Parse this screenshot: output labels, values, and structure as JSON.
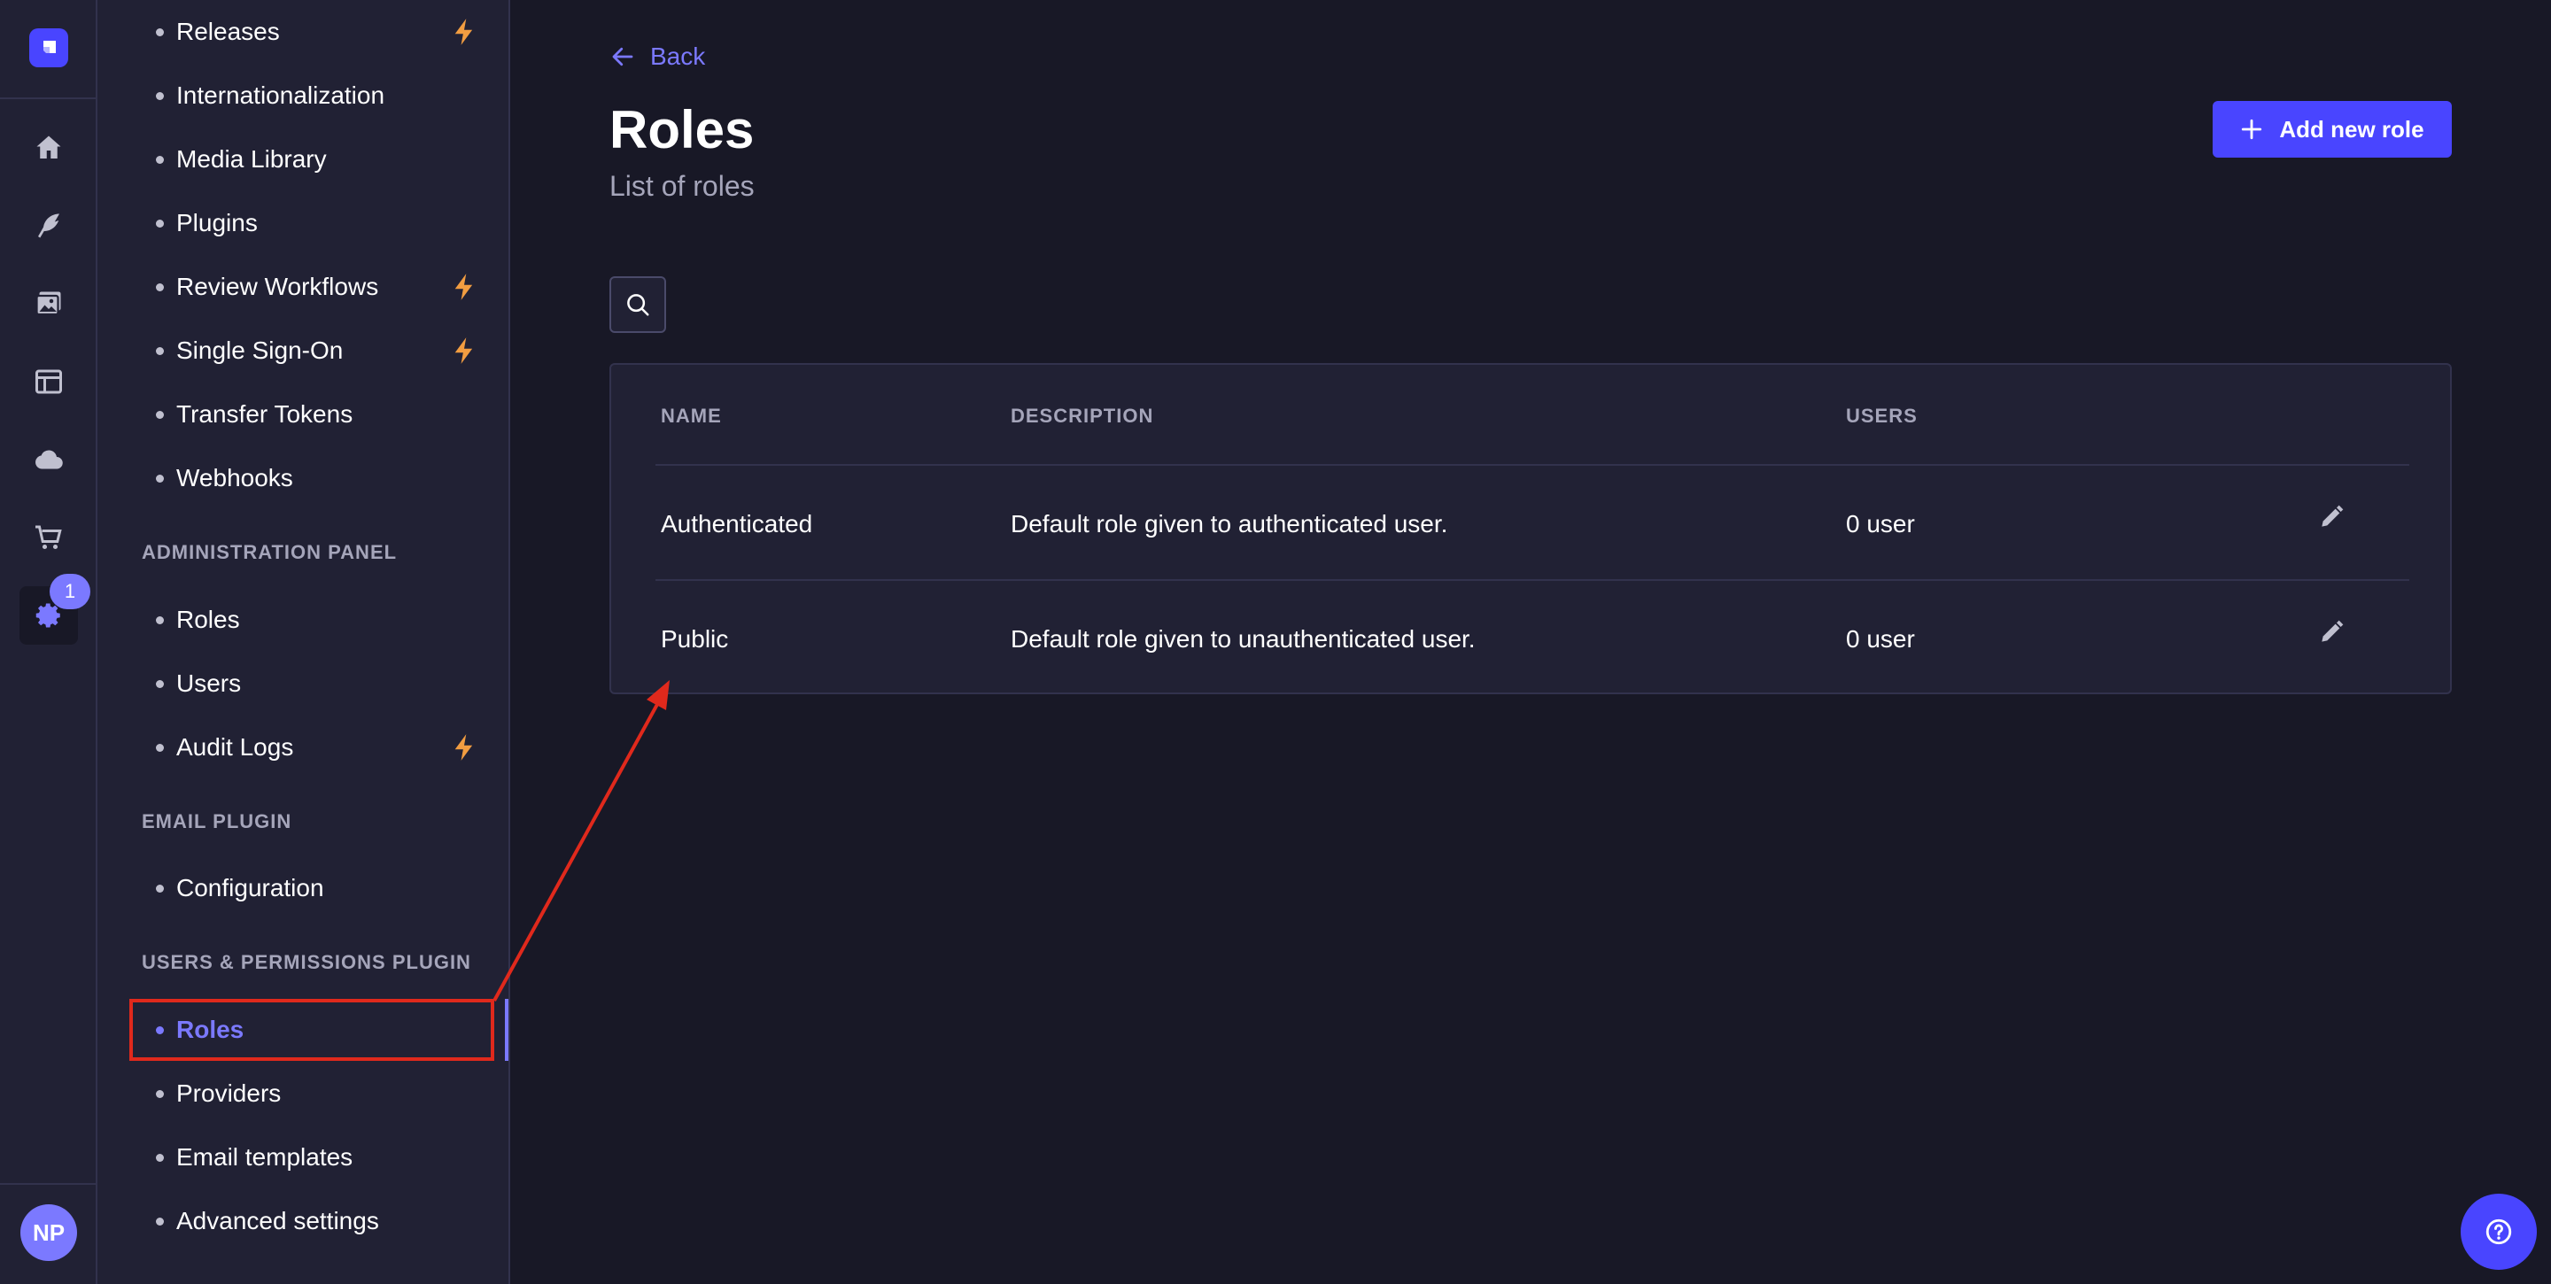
{
  "sidebar": {
    "items_top": [
      {
        "label": "Releases",
        "premium": true
      },
      {
        "label": "Internationalization",
        "premium": false
      },
      {
        "label": "Media Library",
        "premium": false
      },
      {
        "label": "Plugins",
        "premium": false
      },
      {
        "label": "Review Workflows",
        "premium": true
      },
      {
        "label": "Single Sign-On",
        "premium": true
      },
      {
        "label": "Transfer Tokens",
        "premium": false
      },
      {
        "label": "Webhooks",
        "premium": false
      }
    ],
    "admin_section": "ADMINISTRATION PANEL",
    "admin_items": [
      {
        "label": "Roles",
        "premium": false
      },
      {
        "label": "Users",
        "premium": false
      },
      {
        "label": "Audit Logs",
        "premium": true
      }
    ],
    "email_section": "EMAIL PLUGIN",
    "email_items": [
      {
        "label": "Configuration"
      }
    ],
    "up_section": "USERS & PERMISSIONS PLUGIN",
    "up_items": [
      {
        "label": "Roles",
        "active": true
      },
      {
        "label": "Providers"
      },
      {
        "label": "Email templates"
      },
      {
        "label": "Advanced settings"
      }
    ]
  },
  "rail": {
    "icons": [
      "home-icon",
      "feather-icon",
      "images-icon",
      "layout-icon",
      "cloud-icon",
      "cart-icon",
      "settings-icon"
    ],
    "settings_badge": "1",
    "avatar_initials": "NP"
  },
  "header": {
    "back_label": "Back",
    "title": "Roles",
    "subtitle": "List of roles",
    "add_button": "Add new role"
  },
  "table": {
    "headers": {
      "name": "NAME",
      "description": "DESCRIPTION",
      "users": "USERS"
    },
    "rows": [
      {
        "name": "Authenticated",
        "description": "Default role given to authenticated user.",
        "users": "0 user"
      },
      {
        "name": "Public",
        "description": "Default role given to unauthenticated user.",
        "users": "0 user"
      }
    ]
  },
  "colors": {
    "accent": "#4945ff",
    "accent_light": "#7b79ff",
    "premium_bolt": "#f29d41",
    "annotation": "#e0291c",
    "background": "#181826",
    "surface": "#212134"
  }
}
